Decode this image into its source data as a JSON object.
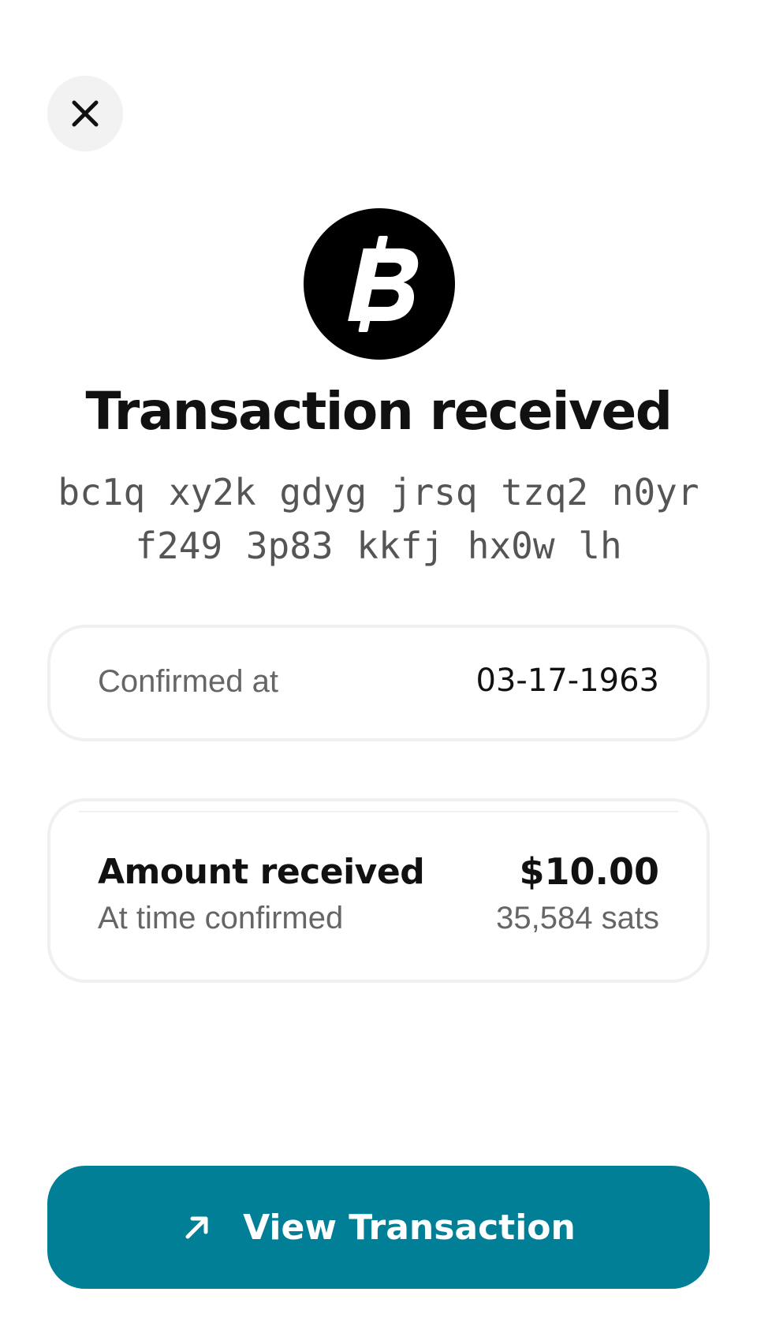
{
  "header": {
    "close_icon": "close-icon"
  },
  "coin": {
    "icon": "bitcoin-icon",
    "color": "#000000"
  },
  "title": "Transaction received",
  "address": {
    "line1": "bc1q xy2k gdyg jrsq tzq2 n0yr",
    "line2": "f249 3p83 kkfj hx0w lh"
  },
  "confirmed": {
    "label": "Confirmed at",
    "value": "03-17-1963"
  },
  "amount": {
    "label": "Amount received",
    "sublabel": "At time confirmed",
    "value": "$10.00",
    "sats": "35,584 sats"
  },
  "action": {
    "label": "View Transaction",
    "icon": "arrow-up-right-icon",
    "color": "#017f96"
  }
}
